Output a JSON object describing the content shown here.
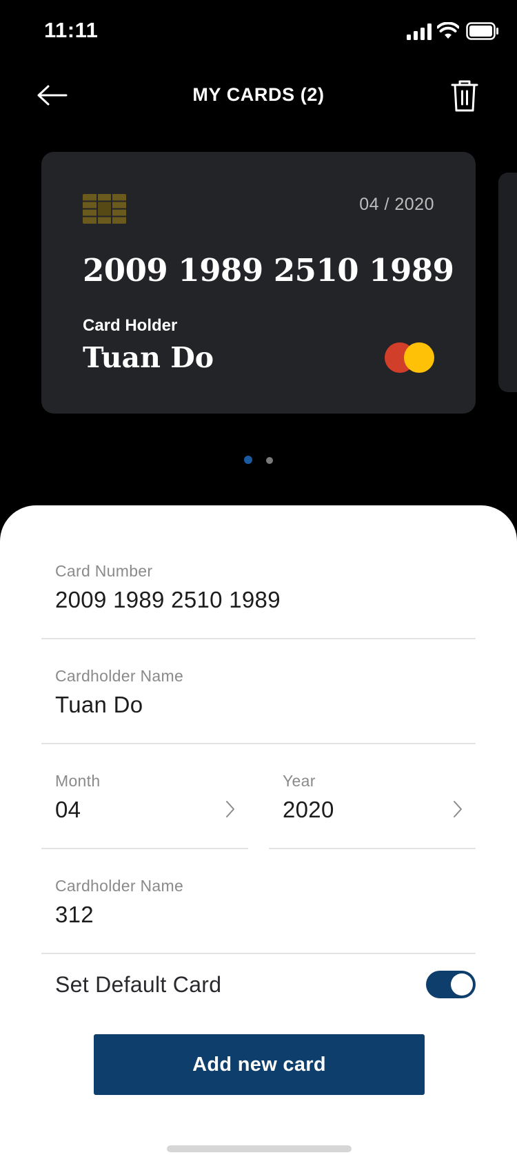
{
  "status_bar": {
    "time": "11:11",
    "icons": [
      "signal-icon",
      "wifi-icon",
      "battery-icon"
    ]
  },
  "nav": {
    "title": "MY CARDS (2)",
    "back_icon": "arrow-left-icon",
    "delete_icon": "trash-icon"
  },
  "card": {
    "chip_icon": "card-chip-icon",
    "expiry": "04 / 2020",
    "number": "2009 1989 2510 1989",
    "holder_label": "Card Holder",
    "holder_name": "Tuan Do",
    "brand_icon": "mastercard-logo-icon"
  },
  "pager": {
    "count": 2,
    "active_index": 0
  },
  "form": {
    "card_number": {
      "label": "Card Number",
      "value": "2009 1989 2510 1989"
    },
    "cardholder_name": {
      "label": "Cardholder Name",
      "value": "Tuan Do"
    },
    "month": {
      "label": "Month",
      "value": "04"
    },
    "year": {
      "label": "Year",
      "value": "2020"
    },
    "cvv": {
      "label": "Cardholder Name",
      "value": "312"
    },
    "default_card": {
      "label": "Set Default Card",
      "enabled": true
    }
  },
  "actions": {
    "add_card_label": "Add new card"
  },
  "colors": {
    "background": "#000000",
    "card": "#232427",
    "accent": "#0e3e6c",
    "mastercard_red": "#d13e2a",
    "mastercard_yellow": "#ffc107",
    "chip": "#6b5a1e"
  }
}
